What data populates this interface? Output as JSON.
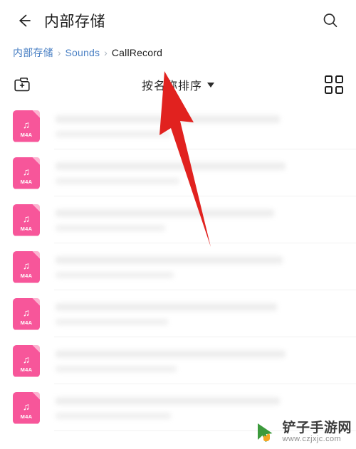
{
  "header": {
    "back_icon": "back-arrow-icon",
    "title": "内部存储",
    "search_icon": "search-icon"
  },
  "breadcrumb": {
    "separator": "›",
    "items": [
      {
        "label": "内部存储",
        "type": "link"
      },
      {
        "label": "Sounds",
        "type": "link"
      },
      {
        "label": "CallRecord",
        "type": "current"
      }
    ]
  },
  "toolbar": {
    "new_folder_icon": "new-folder-icon",
    "sort_label": "按名称排序",
    "sort_caret": "chevron-down-icon",
    "grid_view_icon": "grid-view-icon"
  },
  "file_list": {
    "file_type_badge": "M4A",
    "music_glyph": "♫",
    "icon_color": "#F7569A",
    "icon_fold_color": "#FCB4D1",
    "rows": [
      {
        "name": "",
        "detail": ""
      },
      {
        "name": "",
        "detail": ""
      },
      {
        "name": "",
        "detail": ""
      },
      {
        "name": "",
        "detail": ""
      },
      {
        "name": "",
        "detail": ""
      },
      {
        "name": "",
        "detail": ""
      },
      {
        "name": "",
        "detail": ""
      }
    ]
  },
  "annotation": {
    "arrow_color": "#E1221F",
    "arrow_name": "red-pointer-arrow",
    "points_to": "sort_label"
  },
  "watermark": {
    "logo_icon": "cursor-hand-logo",
    "title": "铲子手游网",
    "url": "www.czjxjc.com",
    "logo_color": "#3C9A3C"
  }
}
